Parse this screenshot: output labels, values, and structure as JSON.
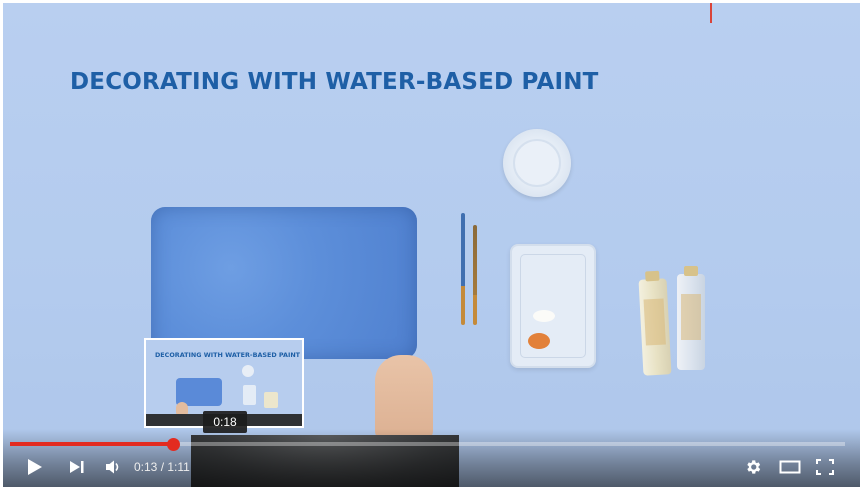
{
  "video": {
    "title": "DECORATING WITH WATER-BASED PAINT"
  },
  "player": {
    "current_time": "0:13",
    "duration": "1:11",
    "time_display": "0:13 / 1:11",
    "progress_fraction": 0.196,
    "accent_color": "#e32b20"
  },
  "preview": {
    "title": "DECORATING WITH WATER-BASED PAINT",
    "time": "0:18"
  },
  "icons": {
    "play": "play-icon",
    "next": "next-icon",
    "volume": "volume-icon",
    "settings": "gear-icon",
    "theater": "theater-mode-icon",
    "fullscreen": "fullscreen-icon"
  }
}
